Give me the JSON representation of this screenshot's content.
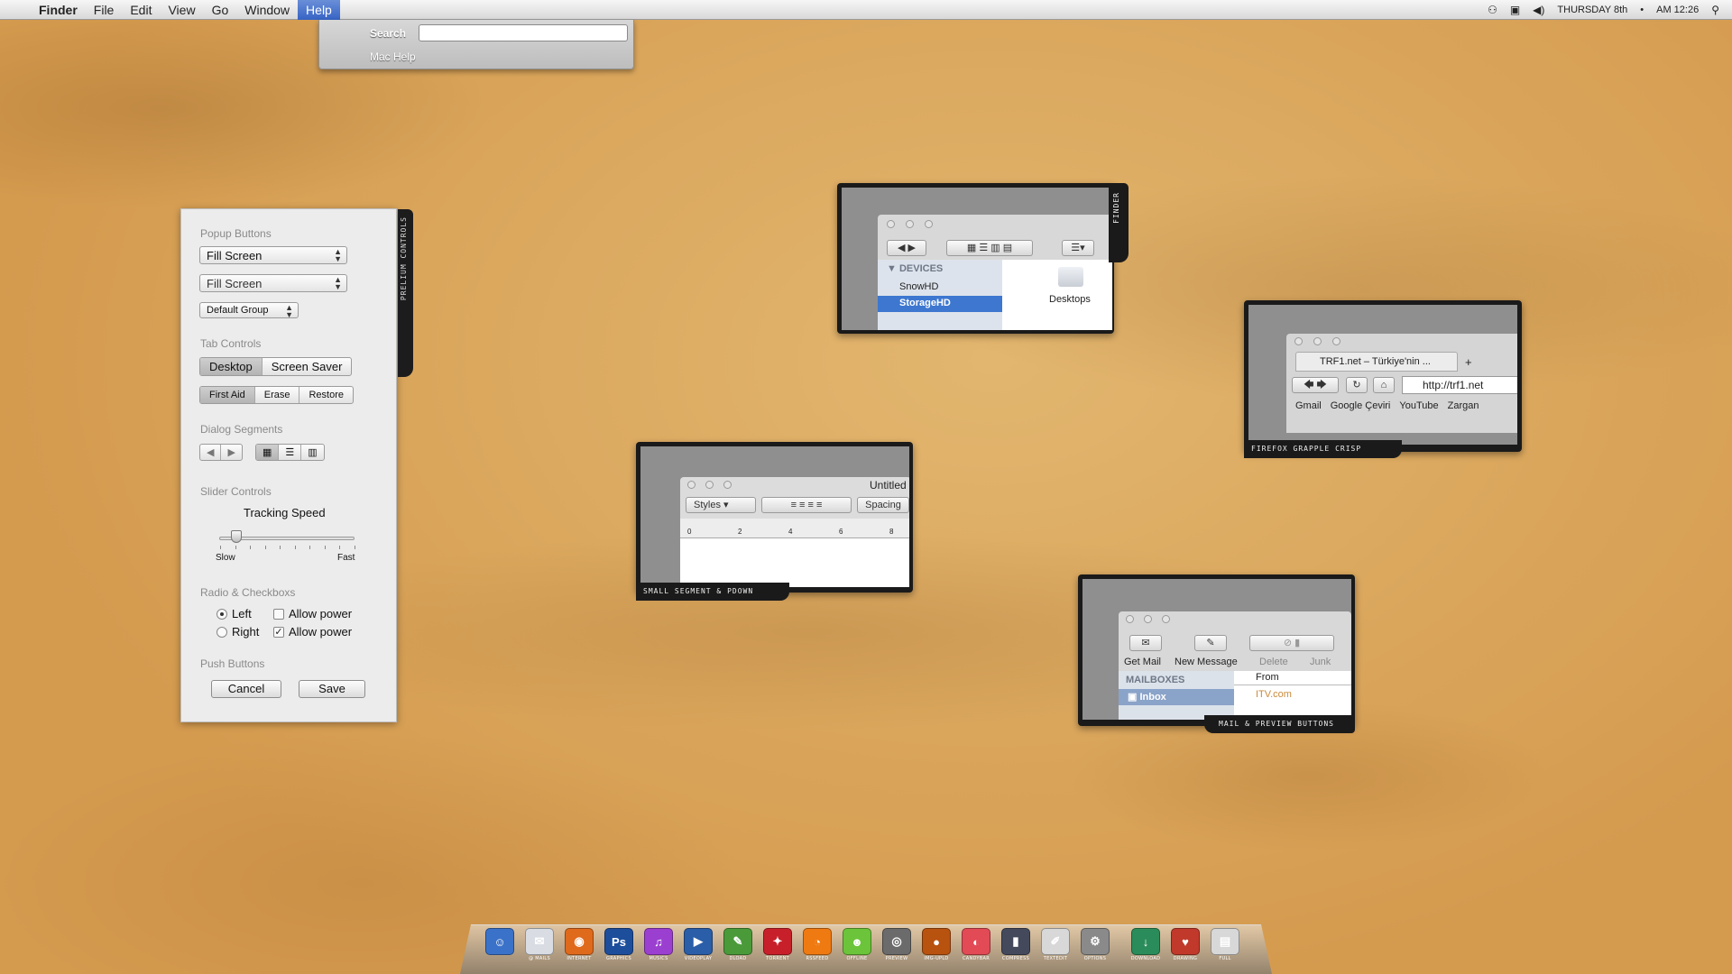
{
  "menubar": {
    "apple": "",
    "items": [
      "Finder",
      "File",
      "Edit",
      "View",
      "Go",
      "Window",
      "Help"
    ],
    "status": {
      "day": "THURSDAY 8th",
      "sep": "•",
      "time": "AM 12:26"
    }
  },
  "help_menu": {
    "search_label": "Search",
    "search_value": "",
    "item": "Mac Help"
  },
  "panel": {
    "tab_caption": "PRELIUM CONTROLS",
    "popup_buttons": {
      "title": "Popup Buttons",
      "popup1": "Fill Screen",
      "popup2": "Fill Screen",
      "popup3": "Default Group"
    },
    "tab_controls": {
      "title": "Tab Controls",
      "tabs": [
        "Desktop",
        "Screen Saver"
      ],
      "tabs_small": [
        "First Aid",
        "Erase",
        "Restore"
      ]
    },
    "dialog_segments": {
      "title": "Dialog Segments",
      "back": "◀",
      "forward": "▶",
      "view_icons": "▦",
      "view_list": "☰",
      "view_columns": "▥"
    },
    "slider_controls": {
      "title": "Slider Controls",
      "label": "Tracking Speed",
      "min_label": "Slow",
      "max_label": "Fast",
      "value": 0.1
    },
    "radio_checkboxes": {
      "title": "Radio & Checkboxs",
      "radio_left": "Left",
      "radio_right": "Right",
      "check1": "Allow power",
      "check2": "Allow power",
      "check_mark": "✓"
    },
    "push_buttons": {
      "title": "Push Buttons",
      "cancel": "Cancel",
      "save": "Save"
    }
  },
  "finder_preview": {
    "caption": "FINDER",
    "devices_header": "DEVICES",
    "devices": [
      "SnowHD",
      "StorageHD"
    ],
    "folder": "Desktops"
  },
  "firefox_preview": {
    "caption": "FIREFOX GRAPPLE CRISP",
    "tab_title": "TRF1.net – Türkiye'nin ...",
    "plus": "+",
    "url": "http://trf1.net",
    "bookmarks": [
      "Gmail",
      "Google Çeviri",
      "YouTube",
      "Zargan"
    ]
  },
  "textedit_preview": {
    "caption": "SMALL SEGMENT & PDOWN",
    "title": "Untitled",
    "styles": "Styles",
    "spacing": "Spacing",
    "ruler": [
      "0",
      "2",
      "4",
      "6",
      "8"
    ]
  },
  "mail_preview": {
    "caption": "MAIL & PREVIEW BUTTONS",
    "buttons": [
      "Get Mail",
      "New Message",
      "Delete",
      "Junk"
    ],
    "mailboxes_header": "MAILBOXES",
    "inbox": "Inbox",
    "from_header": "From",
    "from_value": "ITV.com"
  },
  "dock": {
    "items": [
      {
        "label": "",
        "glyph": "☺",
        "color": "#3b72c9"
      },
      {
        "label": "@ MAILS",
        "glyph": "✉",
        "color": "#d9dde3"
      },
      {
        "label": "INTERNET",
        "glyph": "◉",
        "color": "#e06a1c"
      },
      {
        "label": "GRAPHICS",
        "glyph": "Ps",
        "color": "#1d4e9c"
      },
      {
        "label": "MUSICS",
        "glyph": "♫",
        "color": "#9b3fd0"
      },
      {
        "label": "VIDEOPLAY",
        "glyph": "▶",
        "color": "#2b5ea8"
      },
      {
        "label": "DLOAD",
        "glyph": "✎",
        "color": "#4a9a3a"
      },
      {
        "label": "TORRENT",
        "glyph": "✦",
        "color": "#c8202a"
      },
      {
        "label": "RSSFEED",
        "glyph": "◔",
        "color": "#ef7a12"
      },
      {
        "label": "OFFLINE",
        "glyph": "☻",
        "color": "#6cc43a"
      },
      {
        "label": "PREVIEW",
        "glyph": "◎",
        "color": "#6b6b6b"
      },
      {
        "label": "IMG-UPLD",
        "glyph": "●",
        "color": "#b8520f"
      },
      {
        "label": "CANDYBAR",
        "glyph": "◐",
        "color": "#e24a56"
      },
      {
        "label": "COMPRESS",
        "glyph": "▮",
        "color": "#444a5c"
      },
      {
        "label": "TEXTEDIT",
        "glyph": "✐",
        "color": "#d8d8d8"
      },
      {
        "label": "OPTIONS",
        "glyph": "⚙",
        "color": "#8a8a8a"
      },
      {
        "label": "DOWNLOAD",
        "glyph": "↓",
        "color": "#2a8c5a"
      },
      {
        "label": "DRAWING",
        "glyph": "♥",
        "color": "#c0392b"
      },
      {
        "label": "FULL",
        "glyph": "▤",
        "color": "#d8d8d8"
      }
    ]
  }
}
